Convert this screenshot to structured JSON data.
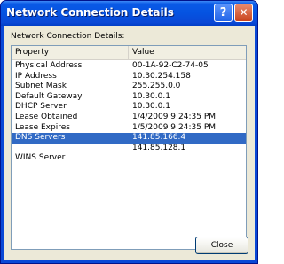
{
  "window": {
    "title": "Network Connection Details"
  },
  "titlebar_buttons": {
    "help": "?",
    "close": "✕"
  },
  "caption": "Network Connection Details:",
  "list": {
    "columns": [
      "Property",
      "Value"
    ],
    "rows": [
      {
        "property": "Physical Address",
        "value": "00-1A-92-C2-74-05",
        "selected": false
      },
      {
        "property": "IP Address",
        "value": "10.30.254.158",
        "selected": false
      },
      {
        "property": "Subnet Mask",
        "value": "255.255.0.0",
        "selected": false
      },
      {
        "property": "Default Gateway",
        "value": "10.30.0.1",
        "selected": false
      },
      {
        "property": "DHCP Server",
        "value": "10.30.0.1",
        "selected": false
      },
      {
        "property": "Lease Obtained",
        "value": "1/4/2009 9:24:35 PM",
        "selected": false
      },
      {
        "property": "Lease Expires",
        "value": "1/5/2009 9:24:35 PM",
        "selected": false
      },
      {
        "property": "DNS Servers",
        "value": "141.85.166.4",
        "selected": true
      },
      {
        "property": "",
        "value": "141.85.128.1",
        "selected": false
      },
      {
        "property": "WINS Server",
        "value": "",
        "selected": false
      }
    ]
  },
  "buttons": {
    "close_label": "Close"
  },
  "colors": {
    "selection": "#316ac5",
    "titlebar": "#0a48d6",
    "dialog_bg": "#ece9d8"
  }
}
